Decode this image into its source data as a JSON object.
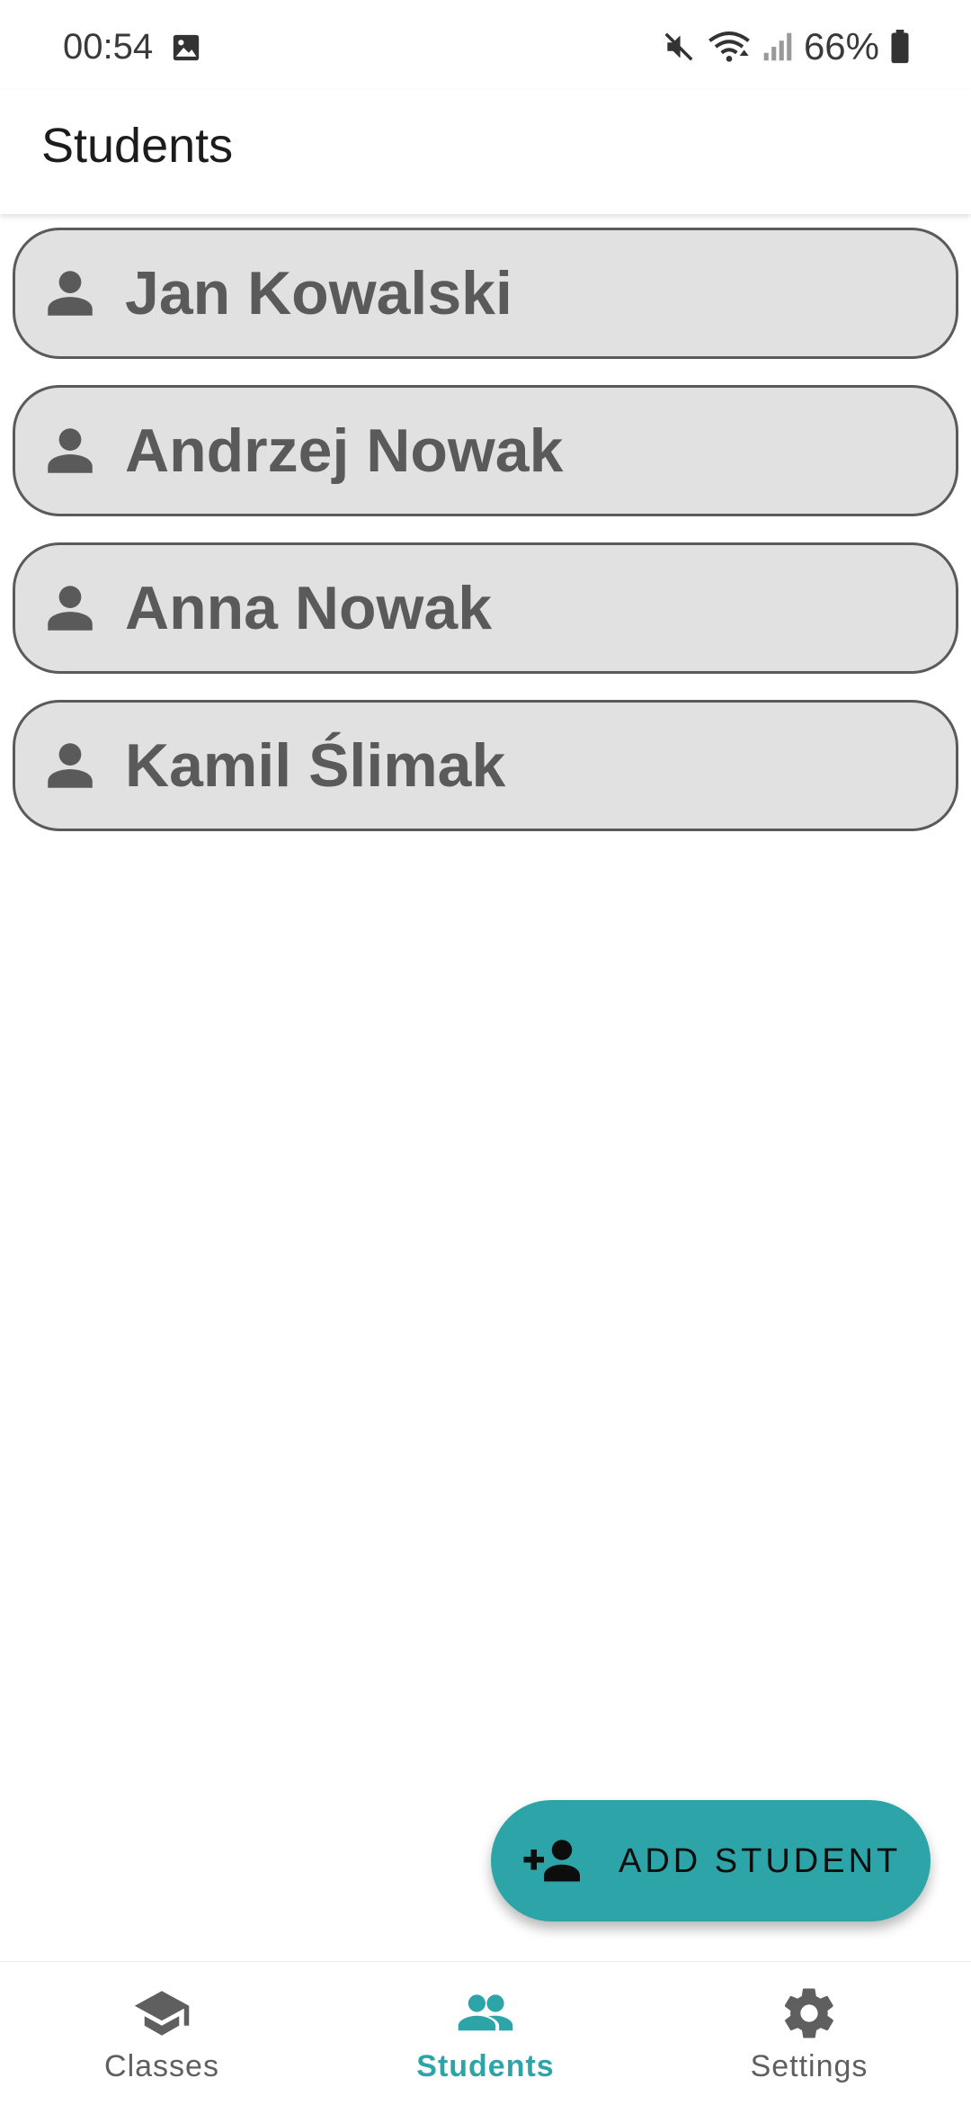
{
  "status_bar": {
    "time": "00:54",
    "battery": "66%",
    "icons": [
      "gallery-icon",
      "mute-icon",
      "wifi-icon",
      "signal-icon",
      "battery-icon"
    ]
  },
  "app_bar": {
    "title": "Students"
  },
  "students": [
    {
      "name": "Jan Kowalski",
      "icon": "person-icon"
    },
    {
      "name": "Andrzej Nowak",
      "icon": "person-icon"
    },
    {
      "name": "Anna Nowak",
      "icon": "person-icon"
    },
    {
      "name": "Kamil Ślimak",
      "icon": "person-icon"
    }
  ],
  "fab": {
    "label": "ADD STUDENT",
    "icon": "person-add-icon"
  },
  "bottom_nav": {
    "items": [
      {
        "label": "Classes",
        "icon": "school-icon",
        "active": false
      },
      {
        "label": "Students",
        "icon": "people-icon",
        "active": true
      },
      {
        "label": "Settings",
        "icon": "gear-icon",
        "active": false
      }
    ]
  },
  "colors": {
    "accent": "#2da5a8",
    "card_bg": "#e1e1e1",
    "card_text": "#5a5a5a",
    "nav_inactive": "#5f5f5f"
  }
}
